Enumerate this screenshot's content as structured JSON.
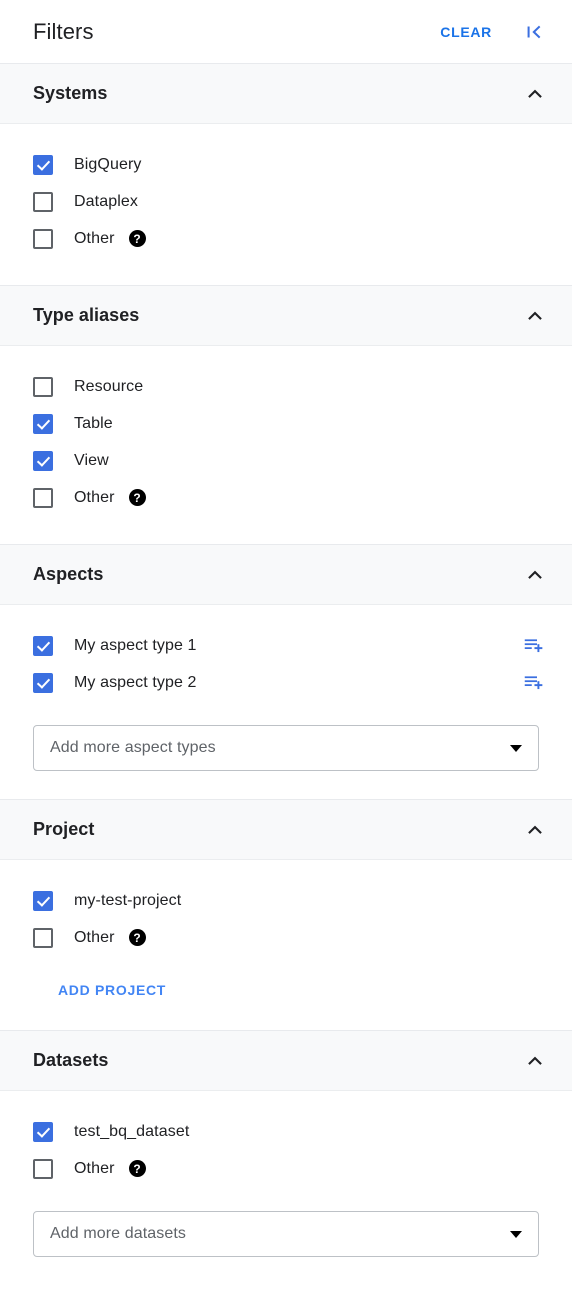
{
  "header": {
    "title": "Filters",
    "clear_label": "CLEAR",
    "collapse_icon": "collapse-panel-left-icon"
  },
  "colors": {
    "accent_blue": "#1a73e8",
    "checkbox_blue": "#3b6fe0",
    "link_blue": "#4285f4",
    "section_bg": "#f8f9fa",
    "text_primary": "#202124",
    "text_secondary": "#5f6368",
    "border": "#e8eaed"
  },
  "sections": [
    {
      "key": "systems",
      "title": "Systems",
      "expanded": true,
      "chevron_icon": "chevron-up-icon",
      "items": [
        {
          "label": "BigQuery",
          "checked": true,
          "help": false
        },
        {
          "label": "Dataplex",
          "checked": false,
          "help": false
        },
        {
          "label": "Other",
          "checked": false,
          "help": true,
          "help_icon": "help-icon"
        }
      ]
    },
    {
      "key": "type_aliases",
      "title": "Type aliases",
      "expanded": true,
      "chevron_icon": "chevron-up-icon",
      "items": [
        {
          "label": "Resource",
          "checked": false,
          "help": false
        },
        {
          "label": "Table",
          "checked": true,
          "help": false
        },
        {
          "label": "View",
          "checked": true,
          "help": false
        },
        {
          "label": "Other",
          "checked": false,
          "help": true,
          "help_icon": "help-icon"
        }
      ]
    },
    {
      "key": "aspects",
      "title": "Aspects",
      "expanded": true,
      "chevron_icon": "chevron-up-icon",
      "items": [
        {
          "label": "My aspect type 1",
          "checked": true,
          "help": false,
          "action_icon": "playlist-add-icon"
        },
        {
          "label": "My aspect type 2",
          "checked": true,
          "help": false,
          "action_icon": "playlist-add-icon"
        }
      ],
      "select": {
        "placeholder": "Add more aspect types",
        "value": "",
        "chevron_icon": "dropdown-arrow-icon"
      }
    },
    {
      "key": "project",
      "title": "Project",
      "expanded": true,
      "chevron_icon": "chevron-up-icon",
      "items": [
        {
          "label": "my-test-project",
          "checked": true,
          "help": false
        },
        {
          "label": "Other",
          "checked": false,
          "help": true,
          "help_icon": "help-icon"
        }
      ],
      "button": {
        "label": "ADD PROJECT"
      }
    },
    {
      "key": "datasets",
      "title": "Datasets",
      "expanded": true,
      "chevron_icon": "chevron-up-icon",
      "items": [
        {
          "label": "test_bq_dataset",
          "checked": true,
          "help": false
        },
        {
          "label": "Other",
          "checked": false,
          "help": true,
          "help_icon": "help-icon"
        }
      ],
      "select": {
        "placeholder": "Add more datasets",
        "value": "",
        "chevron_icon": "dropdown-arrow-icon"
      }
    }
  ]
}
